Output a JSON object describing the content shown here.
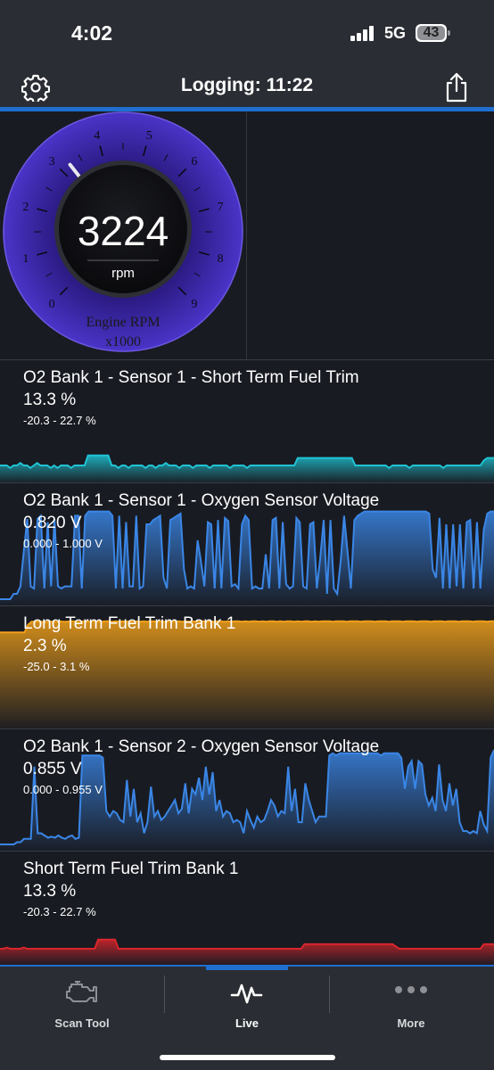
{
  "status_bar": {
    "time": "4:02",
    "network": "5G",
    "battery": "43"
  },
  "header": {
    "title": "Logging: 11:22"
  },
  "gauge": {
    "value": "3224",
    "unit": "rpm",
    "label": "Engine RPM",
    "multiplier": "x1000",
    "ticks": [
      "0",
      "1",
      "2",
      "3",
      "4",
      "5",
      "6",
      "7",
      "8",
      "9"
    ],
    "needle_value": 3.224
  },
  "charts": [
    {
      "name": "O2 Bank 1 - Sensor 1 - Short Term Fuel Trim",
      "value": "13.3 %",
      "range": "-20.3 - 22.7 %",
      "color": "#1fc4d4",
      "min": -20.3,
      "max": 22.7,
      "samples": [
        -16,
        -16,
        -16,
        -17,
        -16,
        -16,
        -15,
        -16,
        -16,
        -17,
        -16,
        -15,
        -16,
        -16,
        -16,
        -17,
        -16,
        -17,
        -16,
        -16,
        -16,
        -17,
        -16,
        -16,
        -16,
        -16,
        -12,
        -12,
        -12,
        -12,
        -12,
        -12,
        -12,
        -16,
        -16,
        -17,
        -16,
        -16,
        -17,
        -16,
        -16,
        -16,
        -16,
        -17,
        -16,
        -16,
        -17,
        -16,
        -16,
        -15,
        -16,
        -16,
        -16,
        -17,
        -16,
        -16,
        -16,
        -17,
        -16,
        -16,
        -16,
        -16,
        -17,
        -16,
        -16,
        -16,
        -16,
        -16,
        -17,
        -16,
        -16,
        -16,
        -16,
        -17,
        -16,
        -16,
        -16,
        -16,
        -16,
        -16,
        -16,
        -16,
        -16,
        -16,
        -16,
        -16,
        -16,
        -16,
        -13,
        -13,
        -13,
        -13,
        -13,
        -13,
        -13,
        -13,
        -13,
        -13,
        -13,
        -13,
        -13,
        -13,
        -13,
        -13,
        -13,
        -16,
        -16,
        -16,
        -16,
        -16,
        -16,
        -16,
        -16,
        -16,
        -16,
        -17,
        -16,
        -16,
        -16,
        -16,
        -16,
        -17,
        -16,
        -16,
        -16,
        -16,
        -16,
        -16,
        -16,
        -16,
        -16,
        -17,
        -16,
        -16,
        -16,
        -16,
        -16,
        -16,
        -16,
        -16,
        -16,
        -16,
        -16,
        -14,
        -13,
        -13,
        -13
      ]
    },
    {
      "name": "O2 Bank 1 - Sensor 1 - Oxygen Sensor Voltage",
      "value": "0.820 V",
      "range": "0.000 - 1.000 V",
      "color": "#3a86e6",
      "min": 0.0,
      "max": 1.0,
      "samples": [
        0.0,
        0.0,
        0.0,
        0.0,
        0.05,
        0.05,
        0.12,
        0.45,
        0.75,
        0.12,
        0.1,
        0.75,
        0.78,
        0.1,
        0.72,
        0.12,
        0.75,
        0.12,
        0.1,
        0.12,
        0.12,
        0.12,
        0.78,
        0.78,
        0.1,
        0.78,
        0.82,
        0.82,
        0.82,
        0.82,
        0.82,
        0.82,
        0.82,
        0.78,
        0.1,
        0.78,
        0.1,
        0.72,
        0.12,
        0.12,
        0.78,
        0.1,
        0.12,
        0.7,
        0.7,
        0.74,
        0.76,
        0.78,
        0.2,
        0.1,
        0.74,
        0.76,
        0.78,
        0.8,
        0.28,
        0.1,
        0.12,
        0.1,
        0.55,
        0.35,
        0.12,
        0.72,
        0.7,
        0.1,
        0.74,
        0.1,
        0.76,
        0.73,
        0.12,
        0.14,
        0.1,
        0.7,
        0.78,
        0.74,
        0.1,
        0.12,
        0.1,
        0.1,
        0.42,
        0.1,
        0.74,
        0.76,
        0.1,
        0.72,
        0.14,
        0.1,
        0.12,
        0.76,
        0.72,
        0.12,
        0.1,
        0.7,
        0.72,
        0.1,
        0.38,
        0.74,
        0.05,
        0.74,
        0.1,
        0.05,
        0.36,
        0.78,
        0.45,
        0.1,
        0.74,
        0.78,
        0.8,
        0.82,
        0.82,
        0.82,
        0.82,
        0.82,
        0.82,
        0.82,
        0.82,
        0.82,
        0.82,
        0.82,
        0.82,
        0.82,
        0.82,
        0.82,
        0.82,
        0.82,
        0.82,
        0.82,
        0.8,
        0.28,
        0.2,
        0.76,
        0.1,
        0.7,
        0.1,
        0.7,
        0.12,
        0.7,
        0.1,
        0.72,
        0.74,
        0.1,
        0.72,
        0.1,
        0.65,
        0.8,
        0.82,
        0.82
      ]
    },
    {
      "name": "Long Term Fuel Trim Bank 1",
      "value": "2.3 %",
      "range": "-25.0 - 3.1 %",
      "color": "#f0a01a",
      "min": -25.0,
      "max": 3.1,
      "samples": [
        -1.4,
        -1.4,
        -1.4,
        -1.4,
        -1.4,
        -1.4,
        -1.4,
        -1.4,
        0.6,
        1.4,
        1.4,
        1.5,
        1.4,
        1.3,
        1.5,
        1.4,
        1.4,
        1.5,
        1.4,
        1.4,
        1.5,
        1.5,
        1.4,
        1.4,
        1.5,
        1.4,
        1.5,
        1.4,
        1.5,
        1.4,
        1.5,
        1.5,
        1.4,
        1.5,
        1.4,
        1.5,
        1.4,
        1.5,
        1.4,
        1.5,
        1.4,
        1.5,
        1.4,
        1.5,
        1.5,
        1.4,
        1.5,
        1.4,
        1.5,
        1.5,
        1.4,
        1.5,
        1.4,
        1.5,
        1.4,
        1.5,
        1.4,
        1.5,
        1.5,
        1.4,
        1.5,
        1.4,
        1.5,
        1.5,
        1.4,
        1.5,
        1.4,
        1.5,
        1.5,
        1.4,
        1.5,
        1.4,
        1.5,
        1.5,
        1.4,
        1.5,
        1.4,
        1.5,
        1.5,
        1.4,
        1.5,
        1.4,
        1.5,
        1.5,
        1.4,
        1.5,
        1.4,
        1.5,
        1.5,
        1.4,
        1.5,
        1.4,
        1.5,
        1.5,
        1.5,
        1.4,
        1.5,
        1.5,
        1.5,
        1.4,
        1.5,
        1.5,
        1.5,
        1.4,
        1.5,
        1.5,
        1.5,
        1.4,
        1.5,
        1.5,
        1.5,
        1.4,
        1.5,
        1.5,
        1.5,
        1.4,
        1.5,
        1.5,
        1.5,
        1.4,
        1.5,
        1.5,
        1.5,
        1.4,
        1.5,
        1.5,
        1.5,
        1.4,
        1.5,
        1.5,
        1.5,
        1.4,
        1.5,
        1.5,
        1.5,
        1.4,
        1.5,
        1.5,
        1.5,
        1.4,
        1.5,
        1.5
      ]
    },
    {
      "name": "O2 Bank 1 - Sensor 2 - Oxygen Sensor Voltage",
      "value": "0.855 V",
      "range": "0.000 - 0.955 V",
      "color": "#3a86e6",
      "min": 0.0,
      "max": 0.955,
      "samples": [
        0.0,
        0.0,
        0.0,
        0.0,
        0.0,
        0.02,
        0.02,
        0.05,
        0.05,
        0.05,
        0.7,
        0.1,
        0.1,
        0.08,
        0.06,
        0.07,
        0.06,
        0.08,
        0.06,
        0.05,
        0.07,
        0.08,
        0.05,
        0.06,
        0.8,
        0.8,
        0.8,
        0.8,
        0.8,
        0.8,
        0.78,
        0.3,
        0.25,
        0.3,
        0.28,
        0.22,
        0.2,
        0.58,
        0.25,
        0.5,
        0.2,
        0.28,
        0.1,
        0.2,
        0.52,
        0.25,
        0.3,
        0.22,
        0.25,
        0.3,
        0.35,
        0.4,
        0.28,
        0.32,
        0.55,
        0.28,
        0.5,
        0.45,
        0.6,
        0.4,
        0.7,
        0.45,
        0.65,
        0.3,
        0.4,
        0.25,
        0.3,
        0.28,
        0.2,
        0.22,
        0.2,
        0.1,
        0.3,
        0.22,
        0.15,
        0.25,
        0.2,
        0.22,
        0.3,
        0.4,
        0.35,
        0.25,
        0.3,
        0.28,
        0.7,
        0.3,
        0.5,
        0.2,
        0.2,
        0.55,
        0.4,
        0.3,
        0.2,
        0.25,
        0.25,
        0.25,
        0.8,
        0.82,
        0.8,
        0.82,
        0.82,
        0.82,
        0.82,
        0.82,
        0.82,
        0.82,
        0.82,
        0.82,
        0.82,
        0.82,
        0.82,
        0.8,
        0.82,
        0.82,
        0.82,
        0.82,
        0.82,
        0.78,
        0.5,
        0.7,
        0.75,
        0.5,
        0.75,
        0.72,
        0.45,
        0.35,
        0.42,
        0.3,
        0.72,
        0.4,
        0.3,
        0.55,
        0.35,
        0.5,
        0.2,
        0.12,
        0.12,
        0.1,
        0.12,
        0.1,
        0.3,
        0.18,
        0.12,
        0.78,
        0.85
      ]
    },
    {
      "name": "Short Term Fuel Trim Bank 1",
      "value": "13.3 %",
      "range": "-20.3 - 22.7 %",
      "color": "#d8262c",
      "min": -20.3,
      "max": 22.7,
      "samples": [
        -16,
        -16,
        -15.5,
        -16,
        -16,
        -16,
        -16,
        -15.5,
        -16,
        -16,
        -16,
        -16,
        -16,
        -16,
        -16,
        -16,
        -16,
        -16,
        -16,
        -16,
        -16,
        -16,
        -16,
        -16,
        -16,
        -16,
        -16,
        -16,
        -16,
        -12,
        -12,
        -12,
        -12,
        -12,
        -12,
        -16,
        -16,
        -16,
        -16,
        -16,
        -16,
        -16,
        -16,
        -16,
        -16,
        -16,
        -16,
        -16,
        -16,
        -16,
        -16,
        -16,
        -16,
        -16,
        -16,
        -16,
        -16,
        -16,
        -16,
        -16,
        -16,
        -16,
        -16,
        -16,
        -16,
        -16,
        -16,
        -16,
        -16,
        -16,
        -16,
        -16,
        -16,
        -16,
        -16,
        -16,
        -16,
        -16,
        -16,
        -16,
        -16,
        -16,
        -16,
        -16,
        -16,
        -16,
        -16,
        -16,
        -16,
        -16,
        -14,
        -14,
        -14,
        -14,
        -14,
        -14,
        -14,
        -14,
        -14,
        -14,
        -14,
        -14,
        -14,
        -14,
        -14,
        -14,
        -14,
        -14,
        -14,
        -14,
        -14,
        -14,
        -14,
        -14,
        -14,
        -14,
        -14,
        -15,
        -16,
        -16,
        -16,
        -16,
        -16,
        -16,
        -16,
        -16,
        -16,
        -16,
        -16,
        -16,
        -16,
        -16,
        -16,
        -16,
        -16,
        -16,
        -16,
        -16,
        -16,
        -16,
        -16,
        -16,
        -16,
        -14,
        -14,
        -14,
        -14
      ]
    }
  ],
  "tabs": [
    {
      "label": "Scan Tool",
      "icon": "engine-icon"
    },
    {
      "label": "Live",
      "icon": "pulse-icon"
    },
    {
      "label": "More",
      "icon": "ellipsis-icon"
    }
  ]
}
